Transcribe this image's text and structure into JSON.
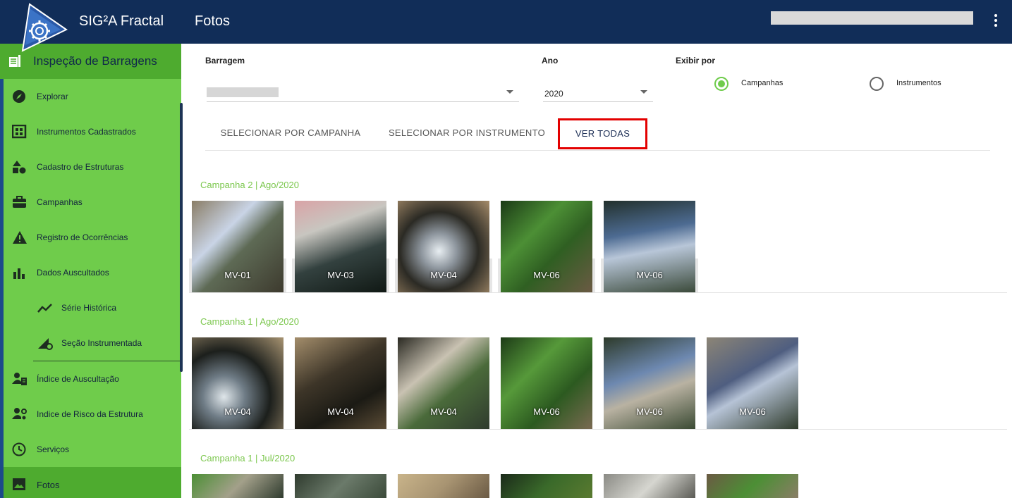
{
  "header": {
    "app_title": "SIG²A Fractal",
    "page_title": "Fotos"
  },
  "sidebar": {
    "section_title": "Inspeção de Barragens",
    "items": [
      {
        "label": "Explorar",
        "icon": "compass-icon"
      },
      {
        "label": "Instrumentos Cadastrados",
        "icon": "dashboard-icon"
      },
      {
        "label": "Cadastro de Estruturas",
        "icon": "shapes-icon"
      },
      {
        "label": "Campanhas",
        "icon": "briefcase-icon"
      },
      {
        "label": "Registro de Ocorrências",
        "icon": "warning-icon"
      },
      {
        "label": "Dados Auscultados",
        "icon": "bar-chart-icon"
      },
      {
        "label": "Série Histórica",
        "icon": "trend-line-icon"
      },
      {
        "label": "Seção Instrumentada",
        "icon": "slope-settings-icon"
      },
      {
        "label": "Índice de Auscultação",
        "icon": "user-document-icon"
      },
      {
        "label": "Indice de Risco da Estrutura",
        "icon": "user-settings-icon"
      },
      {
        "label": "Serviços",
        "icon": "clock-icon"
      },
      {
        "label": "Fotos",
        "icon": "image-icon"
      }
    ]
  },
  "filters": {
    "barragem_label": "Barragem",
    "ano_label": "Ano",
    "ano_value": "2020",
    "exibir_label": "Exibir por",
    "options": [
      "Campanhas",
      "Instrumentos"
    ],
    "selected": "Campanhas"
  },
  "tabs": [
    "SELECIONAR POR CAMPANHA",
    "SELECIONAR POR INSTRUMENTO",
    "VER TODAS"
  ],
  "active_tab": "VER TODAS",
  "colors": {
    "header_bg": "#112d58",
    "sidebar_bg": "#6fcc4b",
    "sidebar_active": "#4eab2f",
    "accent_green": "#7bc74d",
    "tab_highlight": "#e30000"
  },
  "campaigns": [
    {
      "title": "Campanha 2 | Ago/2020",
      "photos": [
        "MV-01",
        "MV-03",
        "MV-04",
        "MV-06",
        "MV-06"
      ]
    },
    {
      "title": "Campanha 1 | Ago/2020",
      "photos": [
        "MV-04",
        "MV-04",
        "MV-04",
        "MV-06",
        "MV-06",
        "MV-06"
      ]
    },
    {
      "title": "Campanha 1 | Jul/2020",
      "photos": [
        "",
        "",
        "",
        "",
        "",
        ""
      ]
    }
  ]
}
